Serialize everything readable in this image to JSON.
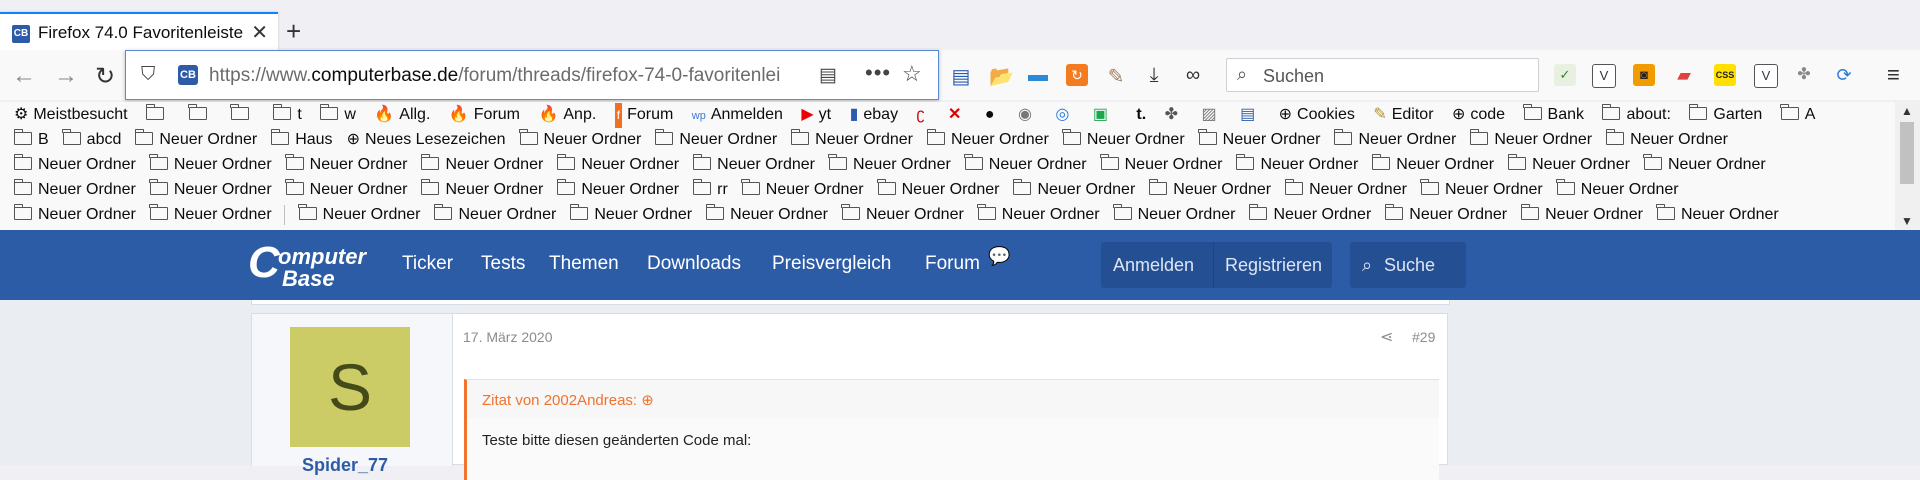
{
  "browser": {
    "tab": {
      "title": "Firefox 74.0 Favoritenleiste",
      "close": "✕"
    },
    "new_tab": "+",
    "nav": {
      "back": "←",
      "forward": "→",
      "reload": "↻"
    },
    "url": {
      "prefix": "https://www.",
      "domain": "computerbase.de",
      "path": "/forum/threads/firefox-74-0-favoritenlei"
    },
    "search_placeholder": "Suchen",
    "menu": "≡"
  },
  "bookmarks": {
    "row1": [
      "Meistbesucht",
      "",
      "",
      "",
      "t",
      "w",
      "Allg.",
      "Forum",
      "Anp.",
      "Forum",
      "Anmelden",
      "yt",
      "ebay",
      "",
      "",
      "",
      "",
      "",
      "",
      "t.",
      "",
      "",
      "",
      "Cookies",
      "Editor",
      "code",
      "Bank",
      "about:",
      "Garten",
      "A"
    ],
    "row2": [
      "B",
      "abcd",
      "Neuer Ordner",
      "Haus",
      "Neues Lesezeichen",
      "Neuer Ordner",
      "Neuer Ordner",
      "Neuer Ordner",
      "Neuer Ordner",
      "Neuer Ordner",
      "Neuer Ordner",
      "Neuer Ordner",
      "Neuer Ordner",
      "Neuer Ordner"
    ],
    "row3": [
      "Neuer Ordner",
      "Neuer Ordner",
      "Neuer Ordner",
      "Neuer Ordner",
      "Neuer Ordner",
      "Neuer Ordner",
      "Neuer Ordner",
      "Neuer Ordner",
      "Neuer Ordner",
      "Neuer Ordner",
      "Neuer Ordner",
      "Neuer Ordner",
      "Neuer Ordner"
    ],
    "row4": [
      "Neuer Ordner",
      "Neuer Ordner",
      "Neuer Ordner",
      "Neuer Ordner",
      "Neuer Ordner",
      "rr",
      "Neuer Ordner",
      "Neuer Ordner",
      "Neuer Ordner",
      "Neuer Ordner",
      "Neuer Ordner",
      "Neuer Ordner",
      "Neuer Ordner"
    ],
    "row5": [
      "Neuer Ordner",
      "Neuer Ordner",
      "Neuer Ordner",
      "Neuer Ordner",
      "Neuer Ordner",
      "Neuer Ordner",
      "Neuer Ordner",
      "Neuer Ordner",
      "Neuer Ordner",
      "Neuer Ordner",
      "Neuer Ordner",
      "Neuer Ordner",
      "Neuer Ordner"
    ]
  },
  "site": {
    "logo_c": "C",
    "logo_line1": "omputer",
    "logo_line2": "Base",
    "nav": [
      "Ticker",
      "Tests",
      "Themen",
      "Downloads",
      "Preisvergleich",
      "Forum"
    ],
    "login": "Anmelden",
    "register": "Registrieren",
    "search": "Suche"
  },
  "post": {
    "avatar_letter": "S",
    "username": "Spider_77",
    "date": "17. März 2020",
    "number": "#29",
    "quote_head": "Zitat von 2002Andreas:",
    "quote_body": "Teste bitte diesen geänderten Code mal:"
  },
  "colors": {
    "accent": "#0a84ff",
    "site_header": "#2d5ca6",
    "quote": "#f0732f",
    "avatar": "#cccc66"
  }
}
